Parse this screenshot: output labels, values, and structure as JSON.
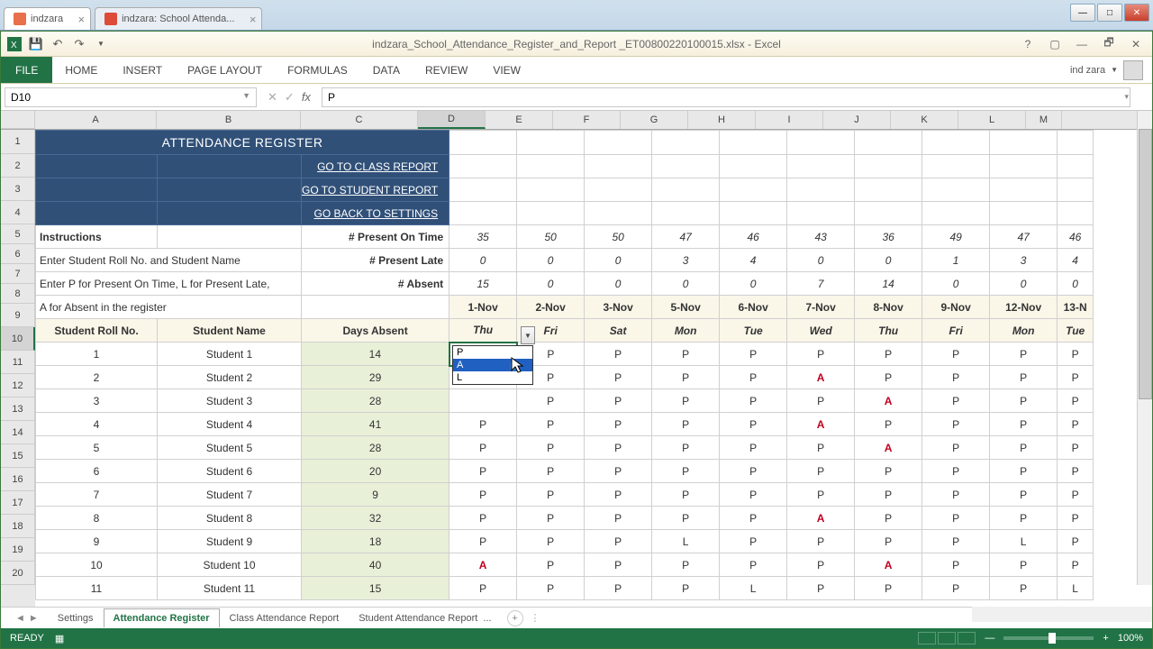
{
  "browser": {
    "tabs": [
      "indzara",
      "indzara: School Attenda..."
    ]
  },
  "window_controls": {
    "min": "—",
    "max": "□",
    "close": "✕"
  },
  "qat": {
    "title": "indzara_School_Attendance_Register_and_Report _ET00800220100015.xlsx - Excel"
  },
  "ribbon": {
    "file": "FILE",
    "tabs": [
      "HOME",
      "INSERT",
      "PAGE LAYOUT",
      "FORMULAS",
      "DATA",
      "REVIEW",
      "VIEW"
    ],
    "user": "ind zara"
  },
  "formula": {
    "name_box": "D10",
    "fx": "fx",
    "value": "P"
  },
  "columns": {
    "A": 135,
    "B": 160,
    "C": 130,
    "D": 75,
    "E": 75,
    "F": 75,
    "G": 75,
    "H": 75,
    "I": 75,
    "J": 75,
    "K": 75,
    "L": 75,
    "M": 40
  },
  "selected_cell": "D10",
  "sheet": {
    "title": "ATTENDANCE REGISTER",
    "links": [
      "GO TO CLASS REPORT",
      "GO TO STUDENT REPORT",
      "GO BACK TO SETTINGS"
    ],
    "instructions_label": "Instructions",
    "instr1": "Enter Student Roll No. and Student Name",
    "instr2": "Enter P for Present On Time, L for Present Late,",
    "instr3": "A for Absent in the register",
    "pres_on_time_label": "# Present On Time",
    "pres_late_label": "# Present Late",
    "absent_label": "# Absent",
    "pres_on_time": [
      35,
      50,
      50,
      47,
      46,
      43,
      36,
      49,
      47,
      46
    ],
    "pres_late": [
      0,
      0,
      0,
      3,
      4,
      0,
      0,
      1,
      3,
      4
    ],
    "absent": [
      15,
      0,
      0,
      0,
      0,
      7,
      14,
      0,
      0,
      0
    ],
    "dates": [
      "1-Nov",
      "2-Nov",
      "3-Nov",
      "5-Nov",
      "6-Nov",
      "7-Nov",
      "8-Nov",
      "9-Nov",
      "12-Nov",
      "13-N"
    ],
    "days": [
      "Thu",
      "Fri",
      "Sat",
      "Mon",
      "Tue",
      "Wed",
      "Thu",
      "Fri",
      "Mon",
      "Tue"
    ],
    "col_roll": "Student Roll No.",
    "col_name": "Student Name",
    "col_days": "Days Absent",
    "students": [
      {
        "roll": 1,
        "name": "Student 1",
        "abs": 14,
        "att": [
          "P",
          "P",
          "P",
          "P",
          "P",
          "P",
          "P",
          "P",
          "P",
          "P"
        ]
      },
      {
        "roll": 2,
        "name": "Student 2",
        "abs": 29,
        "att": [
          "",
          "P",
          "P",
          "P",
          "P",
          "A",
          "P",
          "P",
          "P",
          "P"
        ]
      },
      {
        "roll": 3,
        "name": "Student 3",
        "abs": 28,
        "att": [
          "",
          "P",
          "P",
          "P",
          "P",
          "P",
          "A",
          "P",
          "P",
          "P"
        ]
      },
      {
        "roll": 4,
        "name": "Student 4",
        "abs": 41,
        "att": [
          "P",
          "P",
          "P",
          "P",
          "P",
          "A",
          "P",
          "P",
          "P",
          "P"
        ]
      },
      {
        "roll": 5,
        "name": "Student 5",
        "abs": 28,
        "att": [
          "P",
          "P",
          "P",
          "P",
          "P",
          "P",
          "A",
          "P",
          "P",
          "P"
        ]
      },
      {
        "roll": 6,
        "name": "Student 6",
        "abs": 20,
        "att": [
          "P",
          "P",
          "P",
          "P",
          "P",
          "P",
          "P",
          "P",
          "P",
          "P"
        ]
      },
      {
        "roll": 7,
        "name": "Student 7",
        "abs": 9,
        "att": [
          "P",
          "P",
          "P",
          "P",
          "P",
          "P",
          "P",
          "P",
          "P",
          "P"
        ]
      },
      {
        "roll": 8,
        "name": "Student 8",
        "abs": 32,
        "att": [
          "P",
          "P",
          "P",
          "P",
          "P",
          "A",
          "P",
          "P",
          "P",
          "P"
        ]
      },
      {
        "roll": 9,
        "name": "Student 9",
        "abs": 18,
        "att": [
          "P",
          "P",
          "P",
          "L",
          "P",
          "P",
          "P",
          "P",
          "L",
          "P"
        ]
      },
      {
        "roll": 10,
        "name": "Student 10",
        "abs": 40,
        "att": [
          "A",
          "P",
          "P",
          "P",
          "P",
          "P",
          "A",
          "P",
          "P",
          "P"
        ]
      },
      {
        "roll": 11,
        "name": "Student 11",
        "abs": 15,
        "att": [
          "P",
          "P",
          "P",
          "P",
          "L",
          "P",
          "P",
          "P",
          "P",
          "L"
        ]
      }
    ],
    "dropdown_options": [
      "P",
      "A",
      "L"
    ],
    "dropdown_highlighted": "A"
  },
  "tabs": {
    "list": [
      "Settings",
      "Attendance Register",
      "Class Attendance Report",
      "Student Attendance Report"
    ],
    "active": "Attendance Register",
    "ellipsis": "..."
  },
  "status": {
    "ready": "READY",
    "zoom": "100%",
    "plus": "+",
    "minus": "—"
  }
}
